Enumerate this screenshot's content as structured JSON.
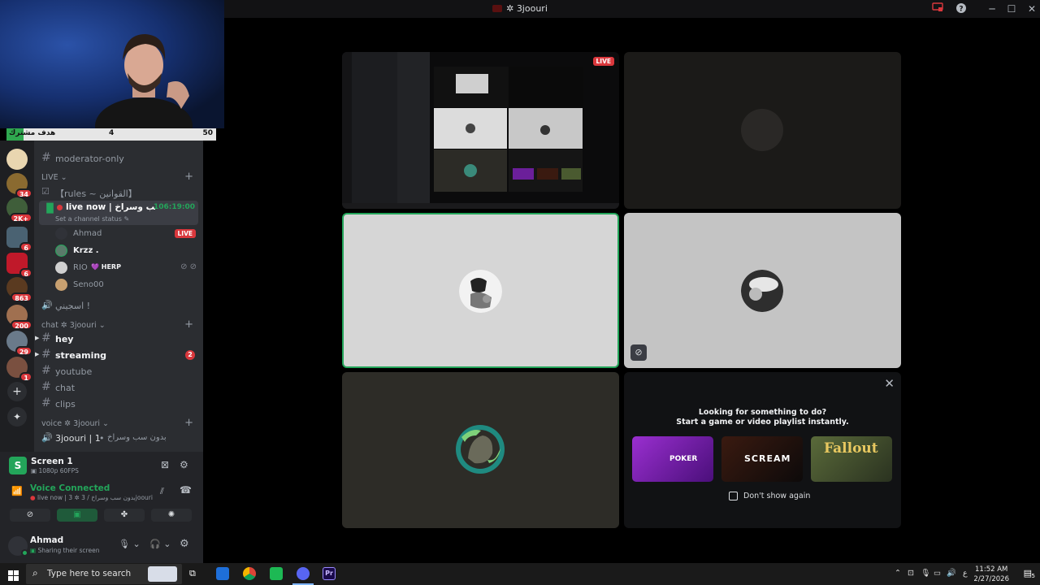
{
  "window": {
    "title": "3joouri",
    "title_prefix": "✲"
  },
  "webcam": {
    "sub_goal_label": "هدف مشترك",
    "sub_goal_current": "4",
    "sub_goal_target": "50",
    "sub_goal_progress": 0.08
  },
  "servers": [
    {
      "badge": ""
    },
    {
      "badge": "34"
    },
    {
      "badge": "2K+"
    },
    {
      "badge": "6"
    },
    {
      "badge": "6"
    },
    {
      "badge": "863"
    },
    {
      "badge": "200"
    },
    {
      "badge": "29"
    },
    {
      "badge": "1"
    }
  ],
  "sidebar": {
    "moderator_only": "moderator-only",
    "cat_live": "LIVE",
    "rules": "【rules ~ القوانين】",
    "live_channel": "live now | بدون سب وسراخ",
    "live_timer": "106:19:00",
    "set_status": "Set a channel status",
    "voice_users": [
      {
        "name": "Ahmad",
        "live": "LIVE"
      },
      {
        "name": "Krzz .",
        "live": ""
      },
      {
        "name": "RIO",
        "tag": "HERP",
        "live": ""
      },
      {
        "name": "Seno00",
        "live": ""
      }
    ],
    "voice_stub": "اسجيني !",
    "cat_chat": "chat ✲ 3joouri",
    "channels": [
      {
        "name": "hey",
        "bright": true,
        "arrow": true,
        "badge": ""
      },
      {
        "name": "streaming",
        "bright": true,
        "arrow": true,
        "badge": "2"
      },
      {
        "name": "youtube",
        "bright": false,
        "arrow": false,
        "badge": ""
      },
      {
        "name": "chat",
        "bright": false,
        "arrow": false,
        "badge": ""
      },
      {
        "name": "clips",
        "bright": false,
        "arrow": false,
        "badge": ""
      }
    ],
    "cat_voice": "voice ✲ 3joouri",
    "voice_channel": "3joouri | 1",
    "voice_channel_ar": "بدون سب وسراخ"
  },
  "screen_panel": {
    "title": "Screen 1",
    "subtitle": "1080p 60FPS"
  },
  "voice_panel": {
    "status": "Voice Connected",
    "channel": "live now | 3 ✲ بدون سب وسراخ / 3joouri"
  },
  "user_panel": {
    "name": "Ahmad",
    "status": "Sharing their screen"
  },
  "stream_tile": {
    "live": "LIVE"
  },
  "activity": {
    "q1": "Looking for something to do?",
    "q2": "Start a game or video playlist instantly.",
    "cards": [
      {
        "label": "POKER",
        "color": "#6b1f9a"
      },
      {
        "label": "SCREAM",
        "color": "#1a0d0d"
      },
      {
        "label": "Fallout",
        "color": "#3a4a2a"
      }
    ],
    "dont_show": "Don't show again"
  },
  "taskbar": {
    "search_placeholder": "Type here to search",
    "time": "11:52 AM",
    "date": "2/27/2026",
    "lang": "ع",
    "notif_count": "5"
  },
  "colors": {
    "accent_green": "#23a55a",
    "live_red": "#da373c",
    "blurple": "#5865f2"
  }
}
